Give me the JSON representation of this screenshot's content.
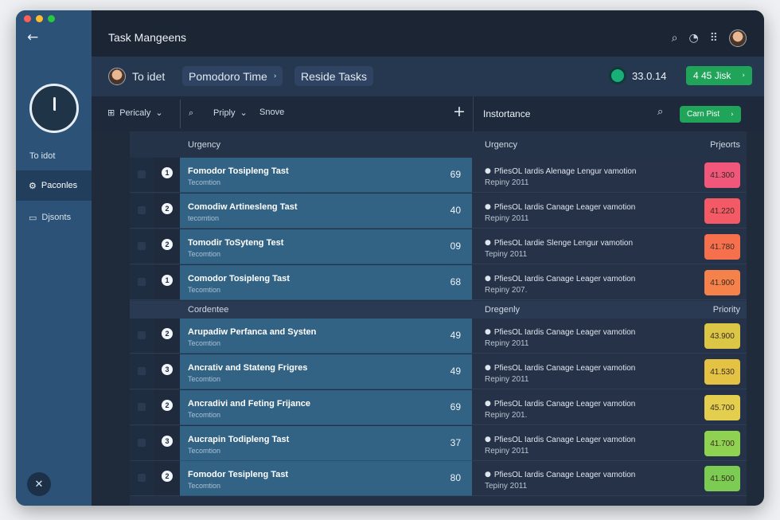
{
  "window": {
    "title": "Task Mangeens",
    "traffic_colors": [
      "#ff5f57",
      "#febc2e",
      "#28c840"
    ]
  },
  "sidebar": {
    "back_icon": "arrow-left-icon",
    "label": "To idot",
    "items": [
      {
        "label": "Paconles",
        "icon": "gear-icon",
        "active": true
      },
      {
        "label": "Djsonts",
        "icon": "folder-icon",
        "active": false
      }
    ]
  },
  "toolbar": {
    "user_label": "To idet",
    "pomodoro_label": "Pomodoro Time",
    "reside_label": "Reside Tasks",
    "status_value": "33.0.14",
    "task_button": "4 45 Jisk"
  },
  "filters": {
    "primary_label": "Pericaly",
    "priority_label": "Priply",
    "snove_label": "Snove"
  },
  "right_panel": {
    "title": "Instortance",
    "button_label": "Carn Pist"
  },
  "table": {
    "left_header": "Urgency",
    "right_header": "Urgency",
    "right_header_col": "Prjeorts",
    "section2_left": "Cordentee",
    "section2_right": "Dregenly",
    "section2_col": "Priority",
    "rows": [
      {
        "num": "1",
        "title": "Fomodor Tosipleng Tast",
        "sub": "Tecomtion",
        "value": "69",
        "d1": "PfiesOL Iardis Alenage Lengur vamotion",
        "d2": "Repiny 2011",
        "badge": "41.300",
        "badge_color": "#f0577a"
      },
      {
        "num": "2",
        "title": "Comodiw Artinesleng Tast",
        "sub": "tecomtion",
        "value": "40",
        "d1": "PfiesOL Iardis Canage Leager vamotion",
        "d2": "Repiny 2011",
        "badge": "41.220",
        "badge_color": "#f35a66"
      },
      {
        "num": "2",
        "title": "Tomodir ToSyteng Test",
        "sub": "Tecomtion",
        "value": "09",
        "d1": "PfiesOL Iardie Slenge Lengur vamotion",
        "d2": "Tepiny 2011",
        "badge": "41.780",
        "badge_color": "#f7704e"
      },
      {
        "num": "1",
        "title": "Comodor Tosipleng Tast",
        "sub": "Tecomtion",
        "value": "68",
        "d1": "PfiesOL Iardis Canage Leager vamotion",
        "d2": "Repiny 207.",
        "badge": "41.900",
        "badge_color": "#f5824a"
      },
      {
        "num": "2",
        "title": "Arupadiw Perfanca and Systen",
        "sub": "Tecomtion",
        "value": "49",
        "d1": "PfiesOL Iardis Canage Leager vamotion",
        "d2": "Repiny 2011",
        "badge": "43.900",
        "badge_color": "#dcc646"
      },
      {
        "num": "3",
        "title": "Ancrativ and Stateng Frigres",
        "sub": "Tecomtion",
        "value": "49",
        "d1": "PfiesOL Iardis Canage Leager vamotion",
        "d2": "Repiny 2011",
        "badge": "41.530",
        "badge_color": "#e3c244"
      },
      {
        "num": "2",
        "title": "Ancradivi and Feting Frijance",
        "sub": "Tecomtion",
        "value": "69",
        "d1": "PfiesOL Iardis Canage Leager vamotion",
        "d2": "Repiny 201.",
        "badge": "45.700",
        "badge_color": "#e4ce4e"
      },
      {
        "num": "3",
        "title": "Aucrapin Todipleng Tast",
        "sub": "Tecomtion",
        "value": "37",
        "d1": "PfiesOL Iardis Canage Leager vamotion",
        "d2": "Repiny 2011",
        "badge": "41.700",
        "badge_color": "#8fd150"
      },
      {
        "num": "2",
        "title": "Fomodor Tesipleng Tast",
        "sub": "Tecomtion",
        "value": "80",
        "d1": "PfiesOL Iardis Canage Leager vamotion",
        "d2": "Tepiny 2011",
        "badge": "41.500",
        "badge_color": "#7ccb52"
      }
    ]
  }
}
